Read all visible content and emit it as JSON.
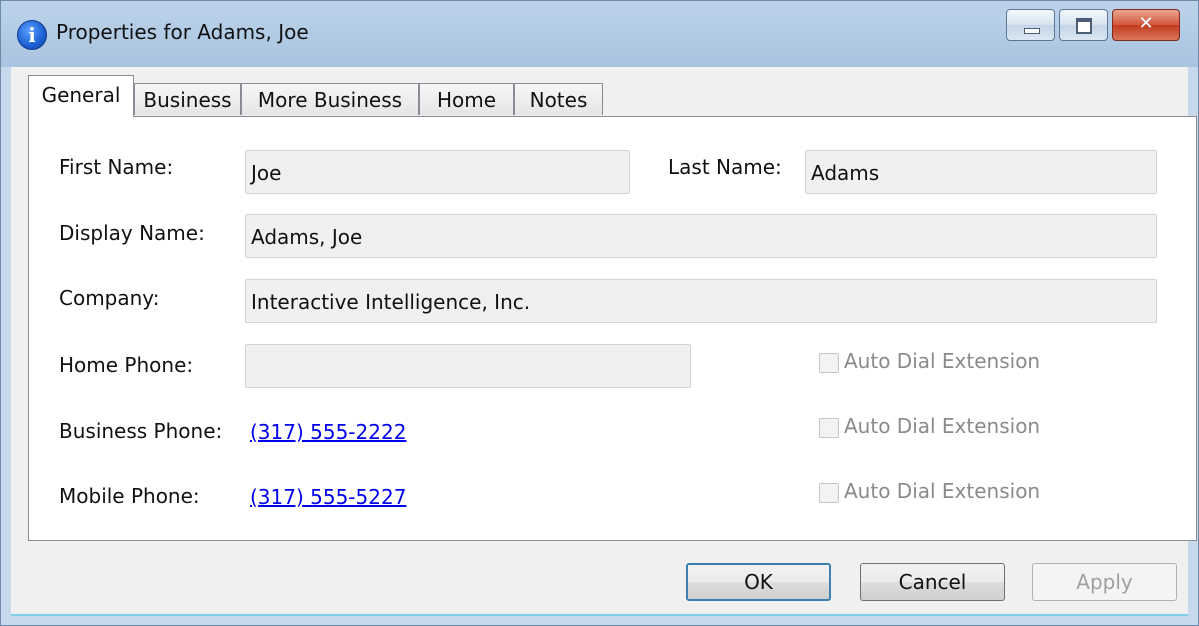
{
  "window": {
    "title": "Properties for Adams, Joe",
    "close_glyph": "✕"
  },
  "tabs": [
    {
      "label": "General"
    },
    {
      "label": "Business"
    },
    {
      "label": "More Business"
    },
    {
      "label": "Home"
    },
    {
      "label": "Notes"
    }
  ],
  "general": {
    "first_name_label": "First Name:",
    "first_name_value": "Joe",
    "last_name_label": "Last Name:",
    "last_name_value": "Adams",
    "display_name_label": "Display Name:",
    "display_name_value": "Adams, Joe",
    "company_label": "Company:",
    "company_value": "Interactive Intelligence, Inc.",
    "home_phone_label": "Home Phone:",
    "home_phone_value": "",
    "business_phone_label": "Business Phone:",
    "business_phone_value": "(317) 555-2222",
    "mobile_phone_label": "Mobile Phone:",
    "mobile_phone_value": "(317) 555-5227",
    "auto_dial_label": "Auto Dial Extension"
  },
  "buttons": {
    "ok": "OK",
    "cancel": "Cancel",
    "apply": "Apply"
  },
  "colors": {
    "link": "#0000ee",
    "info_icon": "#1b5fd3",
    "close_button": "#c23b1f"
  },
  "icons": {
    "title_icon": "info-icon",
    "info_glyph": "i"
  }
}
